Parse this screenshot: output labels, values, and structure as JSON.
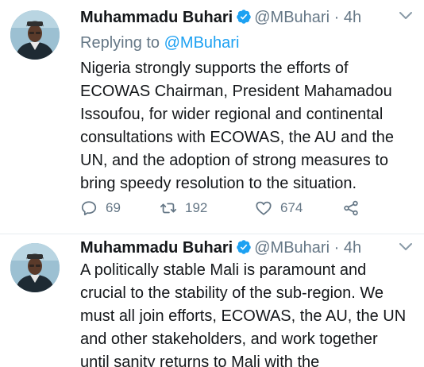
{
  "colors": {
    "link": "#1da1f2",
    "verified": "#1da1f2",
    "muted": "#657786",
    "text": "#14171a"
  },
  "tweets": [
    {
      "author": {
        "name": "Muhammadu Buhari",
        "handle": "@MBuhari",
        "verified": true
      },
      "separator": "·",
      "time": "4h",
      "replying": {
        "prefix": "Replying to",
        "mention": "@MBuhari"
      },
      "text_lines": [
        "Nigeria strongly supports the efforts of",
        "ECOWAS Chairman, President Mahamadou",
        "Issoufou, for wider regional and continental",
        "consultations with ECOWAS, the AU and the",
        "UN, and the adoption of strong measures to",
        "bring speedy resolution to the situation."
      ],
      "actions": {
        "replies": "69",
        "retweets": "192",
        "likes": "674",
        "icons": [
          "reply-icon",
          "retweet-icon",
          "heart-icon",
          "share-icon"
        ]
      }
    },
    {
      "author": {
        "name": "Muhammadu Buhari",
        "handle": "@MBuhari",
        "verified": true
      },
      "separator": "·",
      "time": "4h",
      "text_lines": [
        "A politically stable Mali is paramount and",
        "crucial to the stability of the sub-region. We",
        "must all join efforts, ECOWAS, the AU, the UN",
        "and other stakeholders, and work together",
        "until sanity returns to Mali with the"
      ]
    }
  ]
}
